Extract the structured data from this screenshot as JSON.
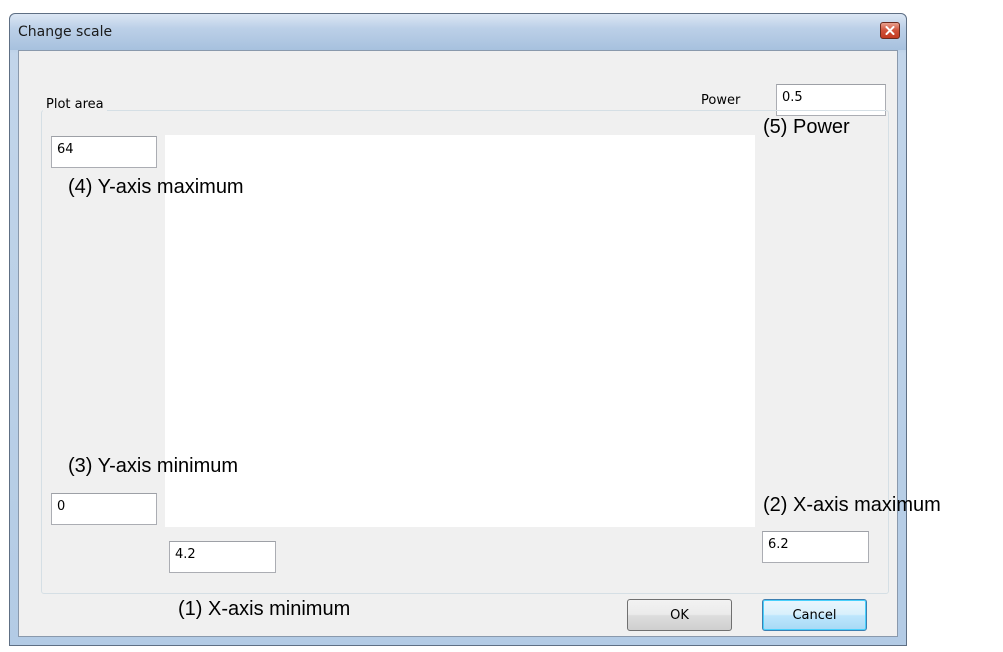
{
  "window": {
    "title": "Change scale"
  },
  "power": {
    "label": "Power",
    "value": "0.5"
  },
  "plot_area": {
    "label": "Plot area",
    "y_max_value": "64",
    "y_min_value": "0",
    "x_min_value": "4.2",
    "x_max_value": "6.2"
  },
  "annotations": {
    "x_min": "(1) X-axis minimum",
    "x_max": "(2) X-axis maximum",
    "y_min": "(3) Y-axis minimum",
    "y_max": "(4) Y-axis maximum",
    "power": "(5) Power"
  },
  "buttons": {
    "ok_label": "OK",
    "cancel_label": "Cancel"
  },
  "icons": {
    "close": "close-icon"
  },
  "colors": {
    "title_bar": "#aac3e0",
    "close_button": "#c23a22",
    "dialog_background": "#f0f0f0",
    "plot_area": "#ffffff",
    "default_button_border": "#3c7fb1"
  }
}
